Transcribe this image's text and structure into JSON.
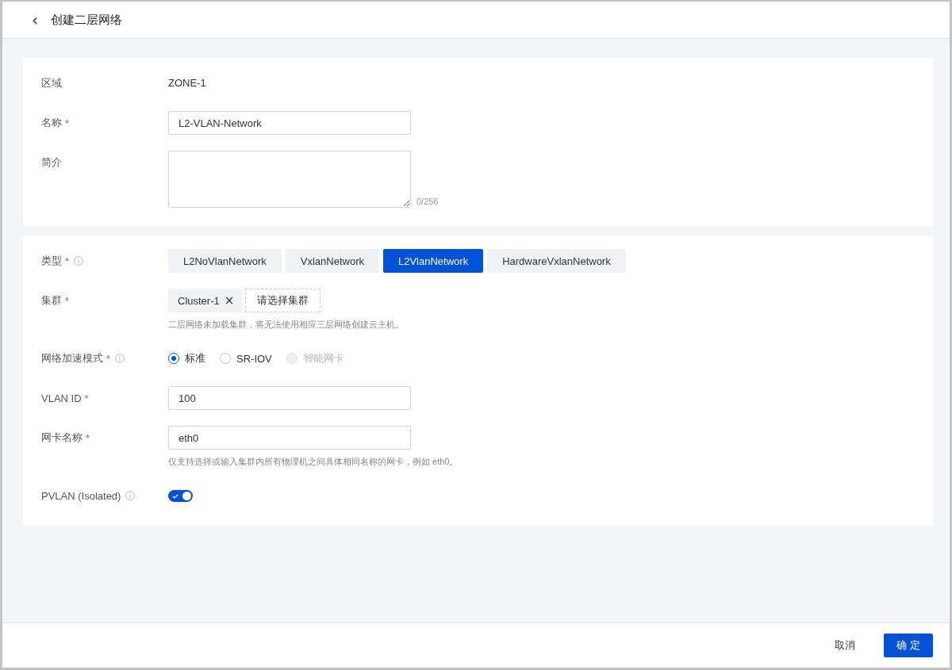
{
  "header": {
    "back": "‹",
    "title": "创建二层网络"
  },
  "sections": [
    {
      "fields": [
        {
          "kind": "text",
          "label": "区域",
          "value": "ZONE-1"
        },
        {
          "kind": "input",
          "label": "名称",
          "required_mark": "*",
          "value": "L2-VLAN-Network"
        },
        {
          "kind": "textarea",
          "label": "简介",
          "counter": "0/256"
        }
      ]
    },
    {
      "fields": [
        {
          "kind": "segmented",
          "label": "类型",
          "required_mark": "*",
          "info": true,
          "options": [
            {
              "label": "L2NoVlanNetwork",
              "selected": false
            },
            {
              "label": "VxlanNetwork",
              "selected": false
            },
            {
              "label": "L2VlanNetwork",
              "selected": true
            },
            {
              "label": "HardwareVxlanNetwork",
              "selected": false
            }
          ]
        },
        {
          "kind": "tags",
          "label": "集群",
          "required_mark": "*",
          "tags": [
            {
              "label": "Cluster-1",
              "remove": "×"
            }
          ],
          "add_button": "请选择集群",
          "hint": "二层网络未加载集群，将无法使用相应三层网络创建云主机。"
        },
        {
          "kind": "radio",
          "label": "网络加速模式",
          "required_mark": "*",
          "info": true,
          "options": [
            {
              "label": "标准",
              "selected": true,
              "disabled": false
            },
            {
              "label": "SR-IOV",
              "selected": false,
              "disabled": false
            },
            {
              "label": "智能网卡",
              "selected": false,
              "disabled": true
            }
          ]
        },
        {
          "kind": "input",
          "label": "VLAN ID",
          "required_mark": "*",
          "value": "100"
        },
        {
          "kind": "input",
          "label": "网卡名称",
          "required_mark": "*",
          "value": "eth0",
          "hint": "仅支持选择或输入集群内所有物理机之间具体相同名称的网卡，例如 eth0。"
        },
        {
          "kind": "switch",
          "label": "PVLAN (Isolated)",
          "info": true,
          "on": true
        }
      ]
    }
  ],
  "footer": {
    "buttons": [
      {
        "label": "取消",
        "kind": "secondary"
      },
      {
        "label": "确 定",
        "kind": "primary"
      }
    ]
  }
}
